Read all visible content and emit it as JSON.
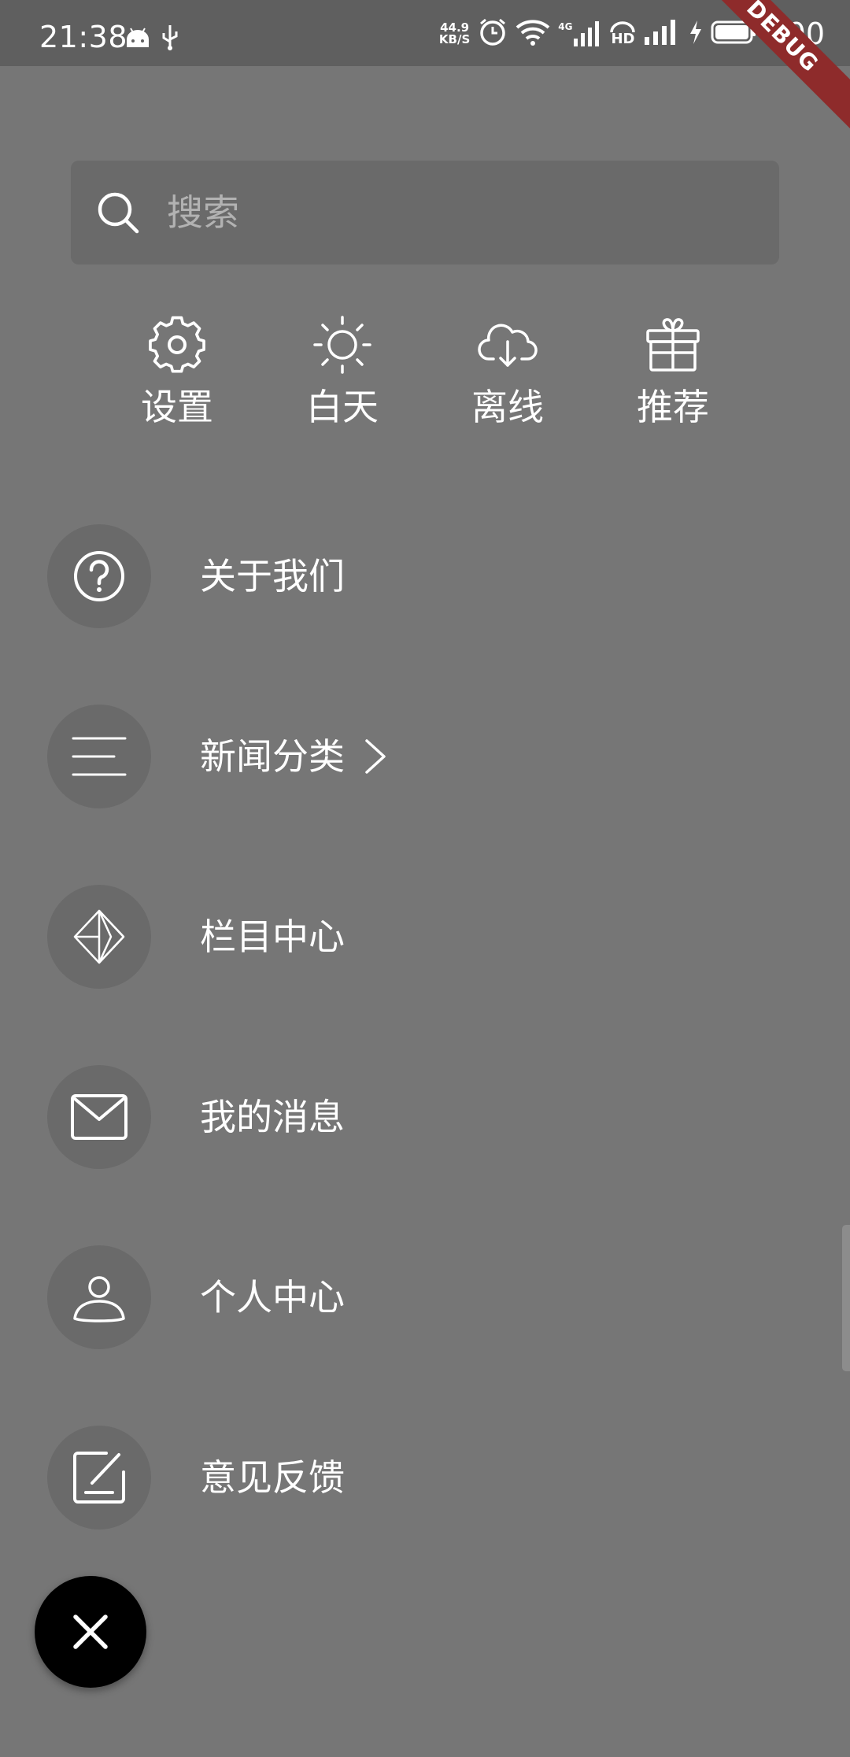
{
  "status_bar": {
    "time": "21:38",
    "net_speed_value": "44.9",
    "net_speed_unit": "KB/S",
    "network_type": "4G",
    "hd_label": "HD",
    "battery": "100",
    "debug_banner": "DEBUG"
  },
  "search": {
    "placeholder": "搜索"
  },
  "quick_actions": [
    {
      "label": "设置",
      "icon": "gear-icon"
    },
    {
      "label": "白天",
      "icon": "sun-icon"
    },
    {
      "label": "离线",
      "icon": "cloud-download-icon"
    },
    {
      "label": "推荐",
      "icon": "gift-icon"
    }
  ],
  "menu": [
    {
      "label": "关于我们",
      "icon": "question-circle-icon"
    },
    {
      "label": "新闻分类",
      "icon": "menu-lines-icon",
      "has_chevron": true
    },
    {
      "label": "栏目中心",
      "icon": "diamond-icon"
    },
    {
      "label": "我的消息",
      "icon": "mail-icon"
    },
    {
      "label": "个人中心",
      "icon": "user-icon"
    },
    {
      "label": "意见反馈",
      "icon": "feedback-icon"
    }
  ],
  "colors": {
    "background": "#767676",
    "status_bar": "#5f5f5f",
    "search_bg": "#6a6a6a",
    "icon_circle": "#6a6a6a",
    "fab": "#000000",
    "debug_banner": "#8e2b2b"
  }
}
